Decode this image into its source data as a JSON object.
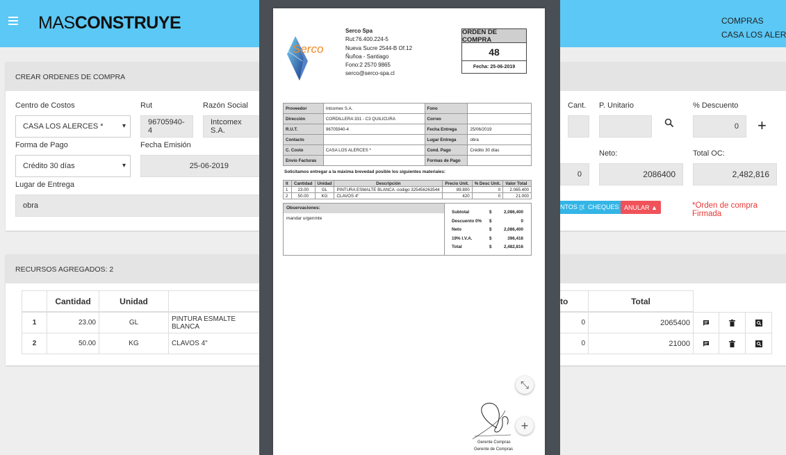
{
  "app": {
    "logo_light": "MAS",
    "logo_bold": "CONSTRUYE",
    "section": "COMPRAS",
    "project": "CASA LOS ALERCES"
  },
  "form": {
    "title": "CREAR ORDENES DE COMPRA",
    "centro_label": "Centro de Costos",
    "centro_value": "CASA LOS ALERCES *",
    "rut_label": "Rut",
    "rut_value": "96705940-4",
    "razon_label": "Razón Social",
    "razon_value": "Intcomex S.A.",
    "pago_label": "Forma de Pago",
    "pago_value": "Crédito 30 días",
    "fecha_label": "Fecha Emisión",
    "fecha_value": "25-06-2019",
    "lugar_label": "Lugar de Entrega",
    "lugar_value": "obra",
    "cant_label": "Cant.",
    "punit_label": "P. Unitario",
    "desc_label": "% Descuento",
    "desc_value": "0",
    "neto_label": "Neto:",
    "neto_value": "2086400",
    "total_label": "Total OC:",
    "total_value": "2,482,816",
    "small_zero": "0",
    "btn_ntos": "NTOS ▯0",
    "btn_cheques": "CHEQUES ▯",
    "btn_anular": "ANULAR ▲",
    "signed_text": "*Orden de compra Firmada"
  },
  "resources": {
    "title": "RECURSOS AGREGADOS: 2",
    "headers": {
      "cantidad": "Cantidad",
      "unidad": "Unidad",
      "desc_partial": "to",
      "total": "Total"
    },
    "rows": [
      {
        "n": "1",
        "cantidad": "23.00",
        "unidad": "GL",
        "desc": "PINTURA ESMALTE BLANCA",
        "dsc": "0",
        "total": "2065400"
      },
      {
        "n": "2",
        "cantidad": "50.00",
        "unidad": "KG",
        "desc": "CLAVOS 4\"",
        "dsc": "0",
        "total": "21000"
      }
    ]
  },
  "doc": {
    "company": {
      "name": "Serco Spa",
      "rut": "Rut:76.400.224-5",
      "addr": "Nueva Sucre 2544-B Of.12",
      "city": "Ñuñoa - Santiago",
      "phone": "Fono:2 2570 9865",
      "email": "serco@serco-spa.cl"
    },
    "logo_text": "Serco",
    "oc": {
      "title": "ORDEN DE COMPRA",
      "number": "48",
      "date": "Fecha: 25-06-2019"
    },
    "info": {
      "proveedor_k": "Proveedor",
      "proveedor_v": "Intcomex S.A.",
      "fono_k": "Fono",
      "fono_v": "",
      "direccion_k": "Dirección",
      "direccion_v": "CORDILLERA 331 - C3 QUILICURA",
      "correo_k": "Correo",
      "correo_v": "",
      "rut_k": "R.U.T.",
      "rut_v": "96705940-4",
      "fentrega_k": "Fecha Entrega",
      "fentrega_v": "25/06/2019",
      "contacto_k": "Contacto",
      "contacto_v": "",
      "lentrega_k": "Lugar Entrega",
      "lentrega_v": "obra",
      "ccosto_k": "C. Costo",
      "ccosto_v": "CASA LOS ALERCES *",
      "cpago_k": "Cond. Pago",
      "cpago_v": "Crédito 30 días",
      "envio_k": "Envío Facturas",
      "envio_v": "",
      "formas_k": "Formas de Pago",
      "formas_v": ""
    },
    "request_text": "Solicitamos entregar a la máxima brevedad posible los siguientes materiales:",
    "items_head": {
      "it": "It",
      "cant": "Cantidad",
      "unidad": "Unidad",
      "desc": "Descripción",
      "precio": "Precio Unit.",
      "dsc": "% Desc Unit.",
      "valor": "Valor Total"
    },
    "items": [
      {
        "it": "1",
        "cant": "23.00",
        "unidad": "GL",
        "desc": "PINTURA ESMALTE BLANCA -codigo 3254562635​44",
        "precio": "89.800",
        "dsc": "0",
        "valor": "2.065.400"
      },
      {
        "it": "2",
        "cant": "50.00",
        "unidad": "KG",
        "desc": "CLAVOS 4\"",
        "precio": "420",
        "dsc": "0",
        "valor": "21.000"
      }
    ],
    "obs_label": "Observaciones:",
    "obs_text": "mandar urgenmte",
    "totals": [
      {
        "k": "Subtotal",
        "c": "$",
        "v": "2,086,400"
      },
      {
        "k": "Descuento 0%",
        "c": "$",
        "v": "0"
      },
      {
        "k": "Neto",
        "c": "$",
        "v": "2,086,400"
      },
      {
        "k": "19% I.V.A.",
        "c": "$",
        "v": "396,416"
      },
      {
        "k": "Total",
        "c": "$",
        "v": "2,482,816"
      }
    ],
    "sign_role": "Gerente Compras",
    "sign_role2": "Gerente de Compras"
  },
  "fabs": {
    "collapse": "⤡",
    "add": "+"
  }
}
